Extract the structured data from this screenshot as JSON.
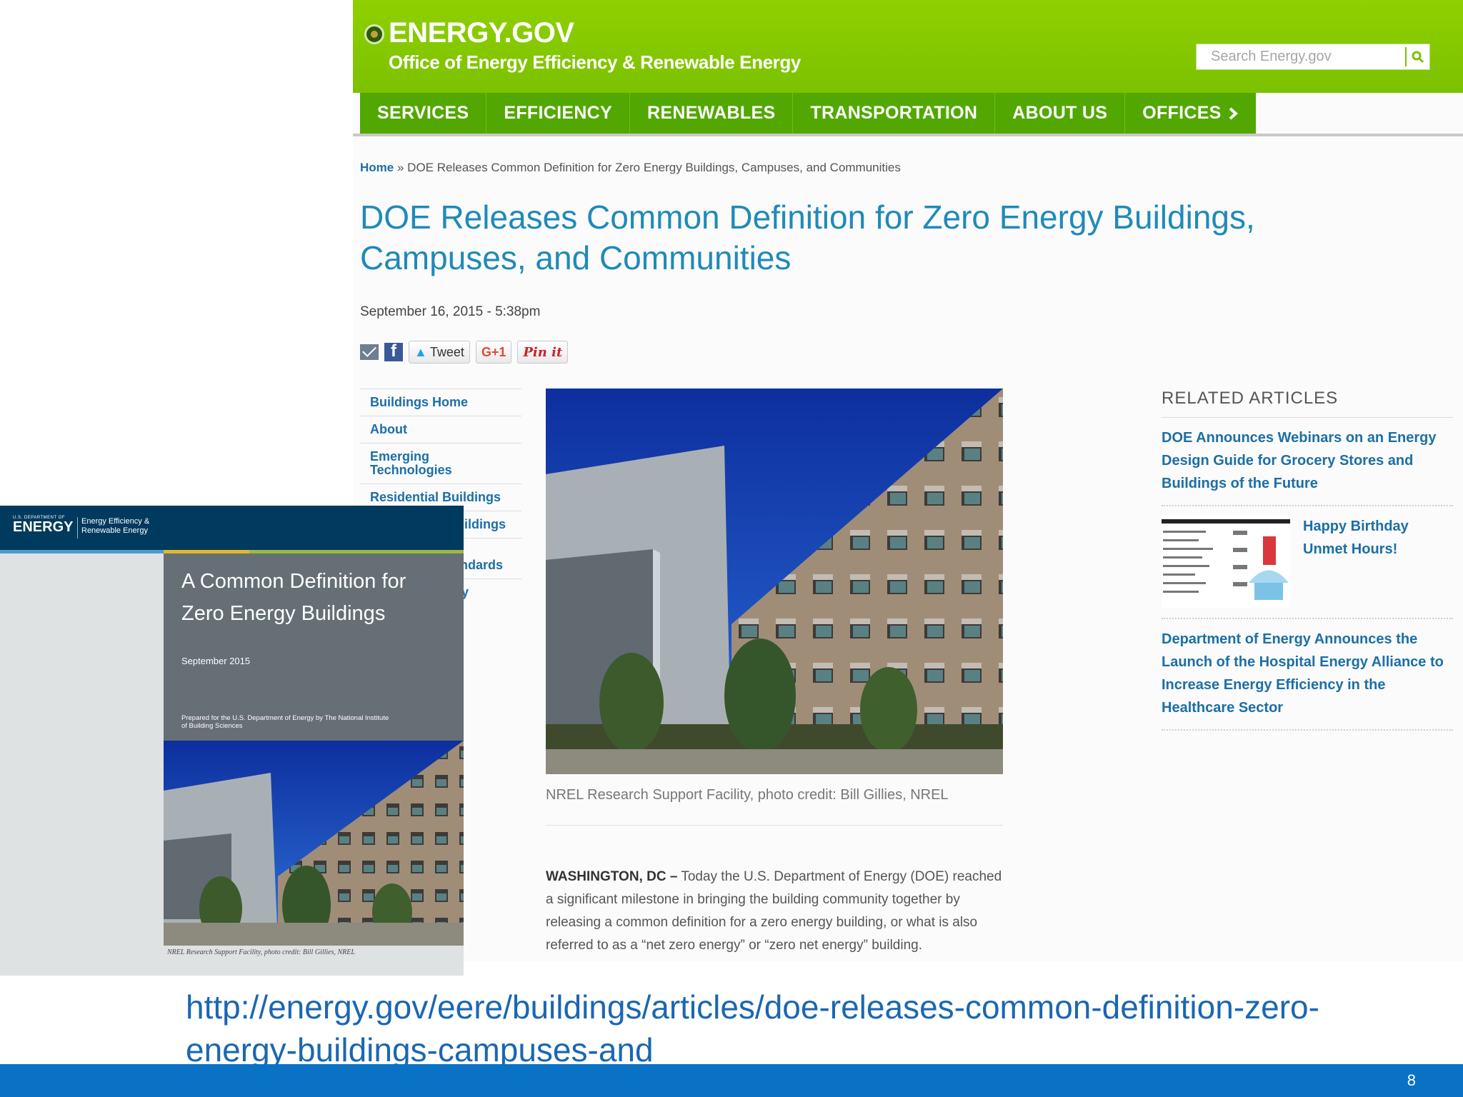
{
  "site": {
    "logo_main": "ENERGY.GOV",
    "logo_sub": "Office of Energy Efficiency & Renewable Energy",
    "search_placeholder": "Search Energy.gov",
    "accent": "#7cc100",
    "nav": [
      "SERVICES",
      "EFFICIENCY",
      "RENEWABLES",
      "TRANSPORTATION",
      "ABOUT US",
      "OFFICES"
    ]
  },
  "breadcrumb": {
    "home": "Home",
    "separator": "»",
    "current": "DOE Releases Common Definition for Zero Energy Buildings, Campuses, and Communities"
  },
  "article": {
    "title": "DOE Releases Common Definition for Zero Energy Buildings, Campuses, and Communities",
    "date": "September 16, 2015 - 5:38pm",
    "share": {
      "tweet": "Tweet",
      "gplus": "G+1",
      "pin": "Pin it"
    },
    "caption": "NREL Research Support Facility, photo credit: Bill Gillies, NREL",
    "dateline": "WASHINGTON, DC –",
    "body": "Today the U.S. Department of Energy (DOE) reached a significant milestone in bringing the building community together by releasing a common definition for a zero energy building, or what is also referred to as a “net zero energy” or “zero net energy” building."
  },
  "sidebar_nav": [
    "Buildings Home",
    "About",
    "Emerging Technologies",
    "Residential Buildings",
    "Commercial Buildings",
    "Appliance & Equipment Standards",
    "Building Energy Codes"
  ],
  "related": {
    "heading": "RELATED ARTICLES",
    "items": [
      "DOE Announces Webinars on an Energy Design Guide for Grocery Stores and Buildings of the Future",
      "Happy Birthday Unmet Hours!",
      "Department of Energy Announces the Launch of the Hospital Energy Alliance to Increase Energy Efficiency in the Healthcare Sector"
    ]
  },
  "cover": {
    "doe_small": "U.S. DEPARTMENT OF",
    "doe_big": "ENERGY",
    "eere": "Energy Efficiency & Renewable Energy",
    "title": "A Common Definition for Zero Energy Buildings",
    "date": "September 2015",
    "prepared": "Prepared for the U.S. Department of Energy by The National Institute of Building Sciences",
    "credit": "NREL Research Support Facility, photo credit: Bill Gillies, NREL"
  },
  "slide": {
    "url": "http://energy.gov/eere/buildings/articles/doe-releases-common-definition-zero-energy-buildings-campuses-and",
    "page_number": "8",
    "bar_color": "#0972c4"
  }
}
